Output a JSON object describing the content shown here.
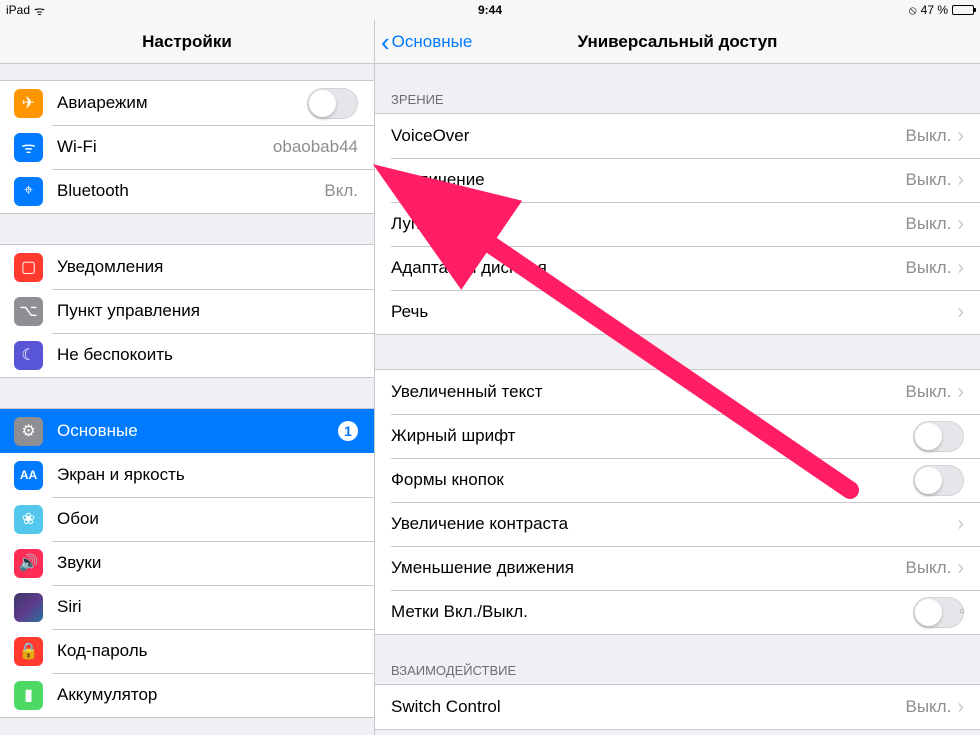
{
  "status": {
    "device": "iPad",
    "time": "9:44",
    "battery_pct": "47 %",
    "orientation_lock": "⦸"
  },
  "sidebar": {
    "title": "Настройки",
    "groups": [
      {
        "rows": [
          {
            "id": "airplane",
            "icon": "airplane-icon",
            "icon_class": "ic-airplane",
            "glyph": "✈",
            "label": "Авиарежим",
            "accessory": "toggle",
            "toggle_on": false
          },
          {
            "id": "wifi",
            "icon": "wifi-icon",
            "icon_class": "ic-wifi",
            "glyph": "ᯤ",
            "label": "Wi-Fi",
            "value": "obaobab44",
            "accessory": "disclosure"
          },
          {
            "id": "bluetooth",
            "icon": "bluetooth-icon",
            "icon_class": "ic-bt",
            "glyph": "⌖",
            "label": "Bluetooth",
            "value": "Вкл.",
            "accessory": "disclosure"
          }
        ]
      },
      {
        "rows": [
          {
            "id": "notifications",
            "icon": "notifications-icon",
            "icon_class": "ic-notif",
            "glyph": "▢",
            "label": "Уведомления",
            "accessory": "disclosure"
          },
          {
            "id": "control-center",
            "icon": "control-center-icon",
            "icon_class": "ic-cc",
            "glyph": "⌥",
            "label": "Пункт управления",
            "accessory": "disclosure"
          },
          {
            "id": "dnd",
            "icon": "dnd-icon",
            "icon_class": "ic-dnd",
            "glyph": "☾",
            "label": "Не беспокоить",
            "accessory": "disclosure"
          }
        ]
      },
      {
        "rows": [
          {
            "id": "general",
            "icon": "general-icon",
            "icon_class": "ic-general",
            "glyph": "⚙",
            "label": "Основные",
            "accessory": "badge-disclosure",
            "badge": "1",
            "selected": true
          },
          {
            "id": "display",
            "icon": "display-icon",
            "icon_class": "ic-display",
            "glyph": "AA",
            "label": "Экран и яркость",
            "accessory": "disclosure"
          },
          {
            "id": "wallpaper",
            "icon": "wallpaper-icon",
            "icon_class": "ic-wall",
            "glyph": "❀",
            "label": "Обои",
            "accessory": "disclosure"
          },
          {
            "id": "sounds",
            "icon": "sounds-icon",
            "icon_class": "ic-sound",
            "glyph": "🔊",
            "label": "Звуки",
            "accessory": "disclosure"
          },
          {
            "id": "siri",
            "icon": "siri-icon",
            "icon_class": "ic-siri",
            "glyph": "",
            "label": "Siri",
            "accessory": "disclosure"
          },
          {
            "id": "passcode",
            "icon": "passcode-icon",
            "icon_class": "ic-passcode",
            "glyph": "🔒",
            "label": "Код-пароль",
            "accessory": "disclosure"
          },
          {
            "id": "battery",
            "icon": "battery-icon",
            "icon_class": "ic-battery",
            "glyph": "▮",
            "label": "Аккумулятор",
            "accessory": "disclosure"
          }
        ]
      }
    ]
  },
  "detail": {
    "back": "Основные",
    "title": "Универсальный доступ",
    "sections": [
      {
        "header": "ЗРЕНИЕ",
        "rows": [
          {
            "label": "VoiceOver",
            "value": "Выкл.",
            "accessory": "disclosure"
          },
          {
            "label": "Увеличение",
            "value": "Выкл.",
            "accessory": "disclosure"
          },
          {
            "label": "Лупа",
            "value": "Выкл.",
            "accessory": "disclosure"
          },
          {
            "label": "Адаптация дисплея",
            "value": "Выкл.",
            "accessory": "disclosure"
          },
          {
            "label": "Речь",
            "accessory": "disclosure"
          }
        ]
      },
      {
        "header": "",
        "rows": [
          {
            "label": "Увеличенный текст",
            "value": "Выкл.",
            "accessory": "disclosure"
          },
          {
            "label": "Жирный шрифт",
            "accessory": "toggle",
            "toggle_on": false
          },
          {
            "label": "Формы кнопок",
            "accessory": "toggle",
            "toggle_on": false
          },
          {
            "label": "Увеличение контраста",
            "accessory": "disclosure"
          },
          {
            "label": "Уменьшение движения",
            "value": "Выкл.",
            "accessory": "disclosure"
          },
          {
            "label": "Метки Вкл./Выкл.",
            "accessory": "toggle",
            "toggle_on": false,
            "mark": true
          }
        ]
      },
      {
        "header": "ВЗАИМОДЕЙСТВИЕ",
        "rows": [
          {
            "label": "Switch Control",
            "value": "Выкл.",
            "accessory": "disclosure"
          }
        ]
      }
    ]
  }
}
